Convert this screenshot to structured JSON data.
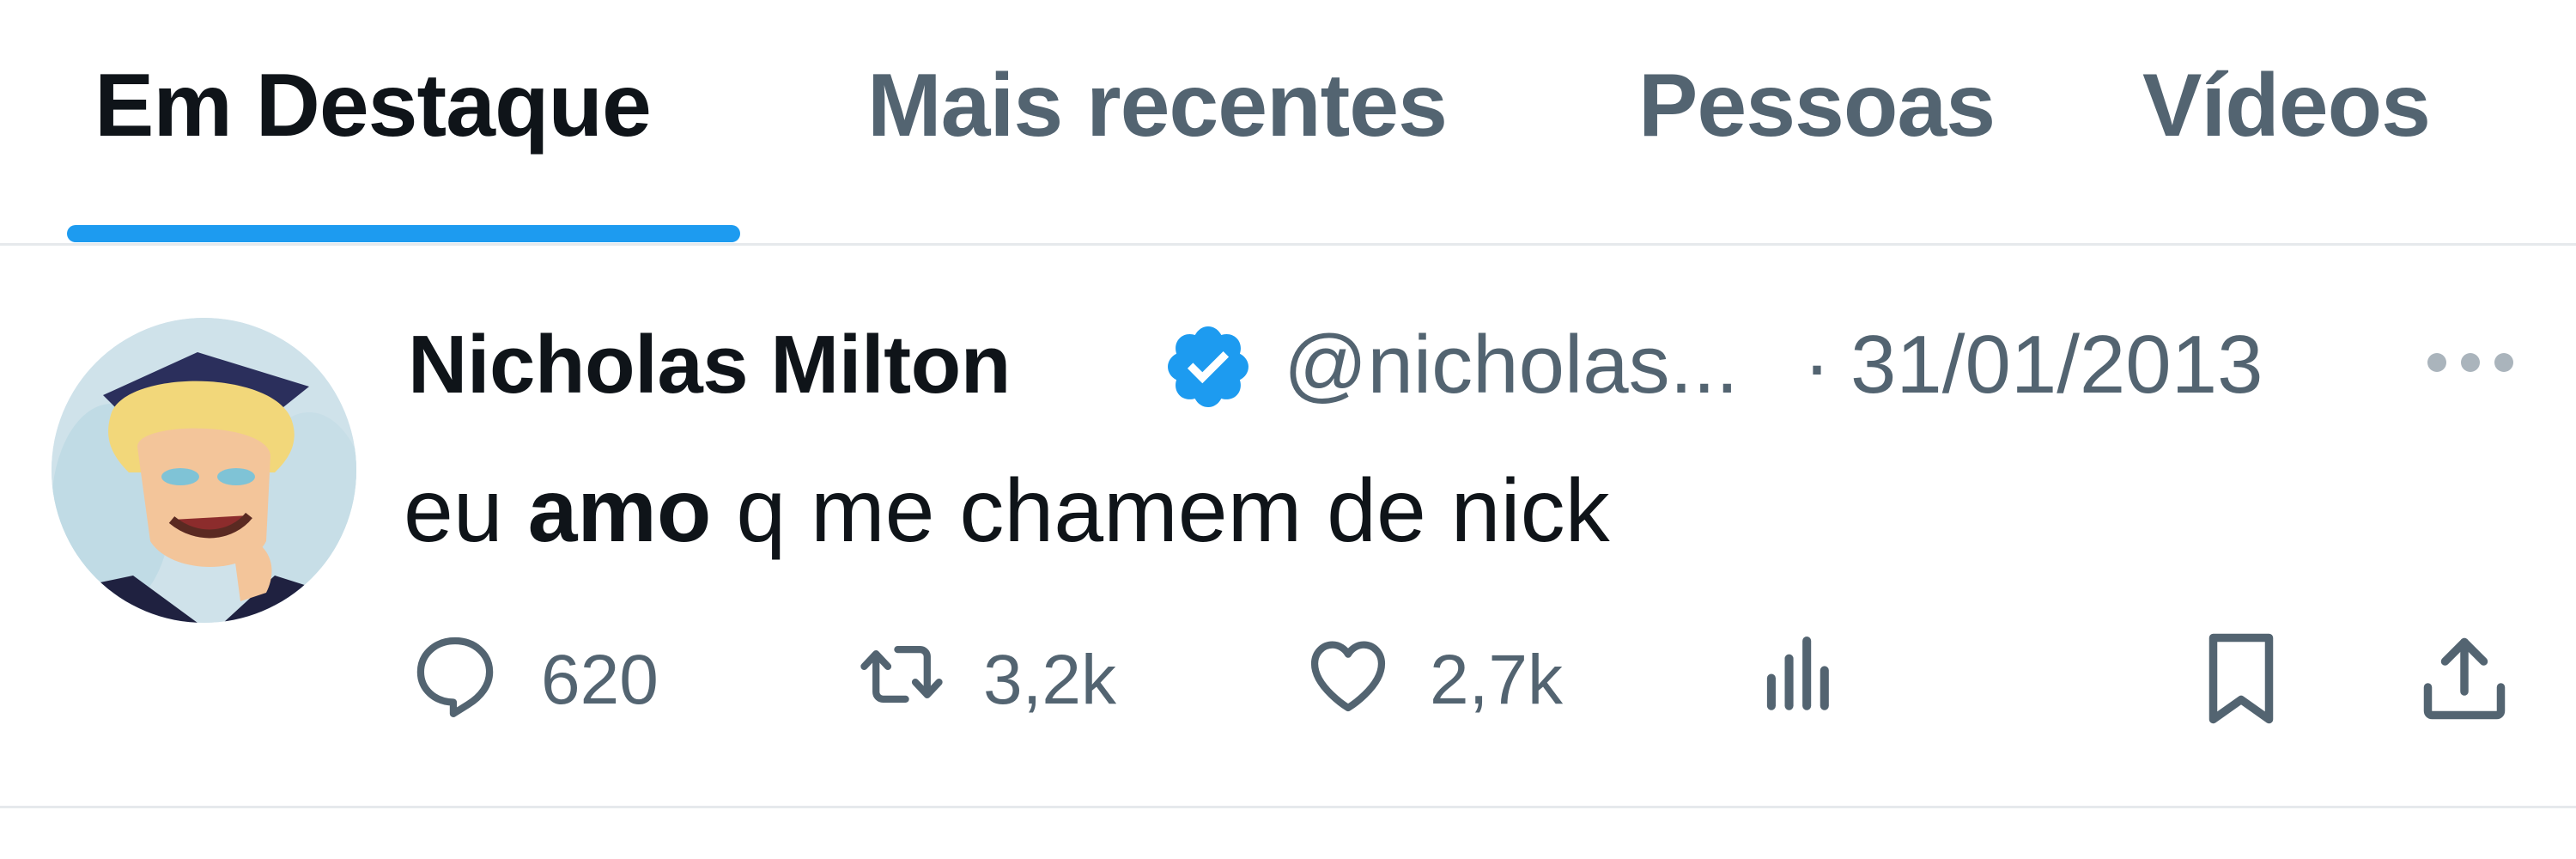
{
  "tabs": [
    {
      "label": "Em Destaque",
      "active": true
    },
    {
      "label": "Mais recentes",
      "active": false
    },
    {
      "label": "Pessoas",
      "active": false
    },
    {
      "label": "Vídeos",
      "active": false
    }
  ],
  "tweet": {
    "author_name": "Nicholas Milton",
    "verified": true,
    "handle": "@nicholas...",
    "separator": "·",
    "date": "31/01/2013",
    "text_before": "eu ",
    "text_bold": "amo",
    "text_after": " q me chamem de nick",
    "actions": {
      "reply_count": "620",
      "retweet_count": "3,2k",
      "like_count": "2,7k"
    }
  },
  "icons": {
    "reply": "reply-icon",
    "retweet": "retweet-icon",
    "like": "heart-icon",
    "views": "views-icon",
    "bookmark": "bookmark-icon",
    "share": "share-icon",
    "more": "more-icon",
    "verified": "verified-badge-icon"
  },
  "colors": {
    "accent": "#1d9bf0",
    "text_primary": "#0f1419",
    "text_secondary": "#536471"
  }
}
